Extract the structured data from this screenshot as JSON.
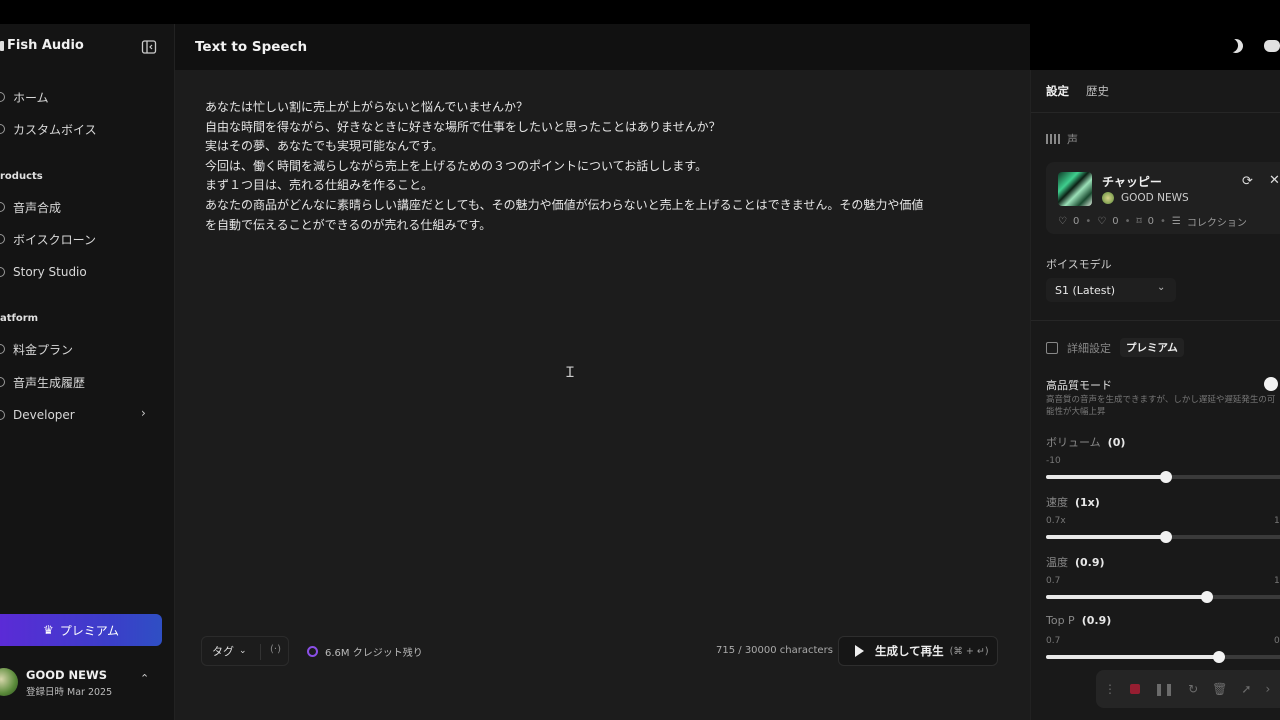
{
  "app": {
    "name": "Fish Audio"
  },
  "sidebar": {
    "nav": [
      {
        "label": "ホーム"
      },
      {
        "label": "カスタムボイス"
      }
    ],
    "products_section": "roducts",
    "products": [
      {
        "label": "音声合成"
      },
      {
        "label": "ボイスクローン"
      },
      {
        "label": "Story Studio"
      }
    ],
    "platform_section": "atform",
    "platform": [
      {
        "label": "料金プラン"
      },
      {
        "label": "音声生成履歴"
      },
      {
        "label": "Developer"
      }
    ],
    "premium_label": "プレミアム",
    "user": {
      "name": "GOOD NEWS",
      "date": "登録日時 Mar 2025"
    }
  },
  "header": {
    "title": "Text to Speech"
  },
  "editor": {
    "lines": [
      "あなたは忙しい割に売上が上がらないと悩んでいませんか？",
      "自由な時間を得ながら、好きなときに好きな場所で仕事をしたいと思ったことはありませんか？",
      "実はその夢、あなたでも実現可能なんです。",
      "今回は、働く時間を減らしながら売上を上げるための３つのポイントについてお話しします。",
      "まず１つ目は、売れる仕組みを作ること。",
      "あなたの商品がどんなに素晴らしい講座だとしても、その魅力や価値が伝わらないと売上を上げることはできません。その魅力や価値",
      "を自動で伝えることができるのが売れる仕組みです。"
    ]
  },
  "bottom_bar": {
    "tag_label": "タグ",
    "brackets": "(·)",
    "credits": "6.6M クレジット残り",
    "char_count": "715 / 30000 characters",
    "generate_label": "生成して再生",
    "generate_shortcut": "(⌘ + ↵)"
  },
  "panel": {
    "tabs": [
      "設定",
      "歴史"
    ],
    "voice_section": "声",
    "voice": {
      "name": "チャッピー",
      "author": "GOOD NEWS",
      "likes": "0",
      "hearts": "0",
      "saves": "0",
      "collection": "コレクション"
    },
    "model_label": "ボイスモデル",
    "model_value": "S1 (Latest)",
    "advanced_label": "詳細設定",
    "premium_badge": "プレミアム",
    "hq_label": "高品質モード",
    "hq_desc": "高音質の音声を生成できますが、しかし遅延や遅延発生の可能性が大幅上昇",
    "hq_enabled": true,
    "sliders": [
      {
        "label": "ボリューム",
        "value": "(0)",
        "min": "-10",
        "max": "",
        "level": 0.5
      },
      {
        "label": "速度",
        "value": "(1x)",
        "min": "0.7x",
        "max": "1.",
        "level": 0.5
      },
      {
        "label": "温度",
        "value": "(0.9)",
        "min": "0.7",
        "max": "1",
        "level": 0.67
      },
      {
        "label": "Top P",
        "value": "(0.9)",
        "min": "0.7",
        "max": "0.",
        "level": 0.72
      }
    ]
  },
  "colors": {
    "accent_purple": "#5b2bd6",
    "credit_ring": "#8a4fe6",
    "record_red": "#c0203a"
  }
}
